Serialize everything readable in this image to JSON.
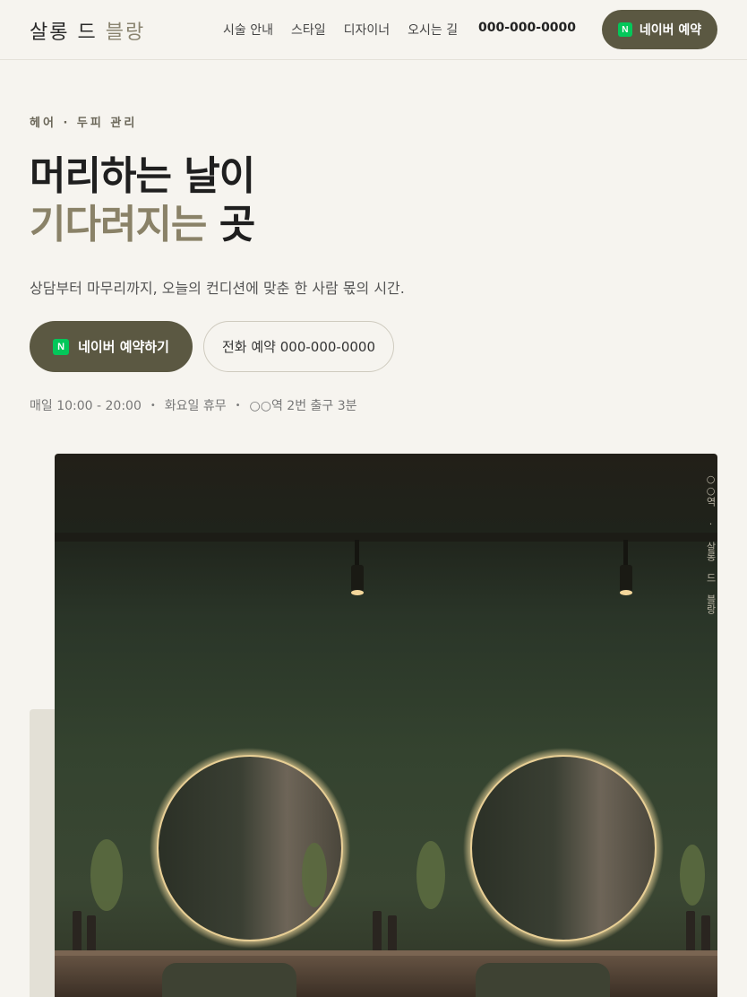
{
  "header": {
    "logo_main": "살롱 드 ",
    "logo_accent": "블랑",
    "nav": [
      "시술 안내",
      "스타일",
      "디자이너",
      "오시는 길"
    ],
    "phone": "000-000-0000",
    "cta_badge": "N",
    "cta_label": "네이버 예약"
  },
  "hero": {
    "eyebrow": "헤어 · 두피 관리",
    "headline_line1": "머리하는 날이",
    "headline_line2_accent": "기다려지는",
    "headline_line2_rest": " 곳",
    "subtitle": "상담부터 마무리까지, 오늘의 컨디션에 맞춘 한 사람 몫의 시간.",
    "primary_badge": "N",
    "primary_label": "네이버 예약하기",
    "secondary_label": "전화 예약 000-000-0000",
    "info": [
      "매일 10:00 - 20:00",
      "화요일 휴무",
      "○○역 2번 출구 3분"
    ],
    "info_separator": "•",
    "image_caption_vertical": "○○역 · 살롱 드 블랑"
  },
  "colors": {
    "background": "#f6f4ef",
    "brand": "#5b5842",
    "accent_text": "#8a8268",
    "naver_green": "#03c75a"
  },
  "icons": [
    "naver-icon"
  ]
}
